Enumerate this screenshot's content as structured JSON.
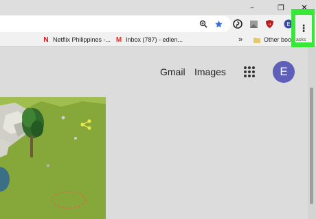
{
  "window_controls": {
    "minimize": "–",
    "maximize": "❐",
    "close": "✕"
  },
  "toolbar": {
    "icons": [
      "zoom-icon",
      "bookmark-star-icon",
      "pinterest-icon",
      "extension-icon",
      "ublock-icon",
      "extension-e-icon"
    ],
    "star_color": "#3d6fd6",
    "menu_icon": "⋮"
  },
  "bookmarks": {
    "items": [
      {
        "label": "Netflix Philippines -...",
        "icon": "N",
        "icon_color": "#e50914"
      },
      {
        "label": "Inbox (787) - edlen...",
        "icon": "M",
        "icon_color": "#d93025"
      }
    ],
    "overflow": "»",
    "other": "Other boo",
    "tasks_label": "asks"
  },
  "header": {
    "gmail": "Gmail",
    "images": "Images",
    "avatar_letter": "E",
    "avatar_color": "#5d5fb9"
  },
  "highlight_color": "#39e63a"
}
